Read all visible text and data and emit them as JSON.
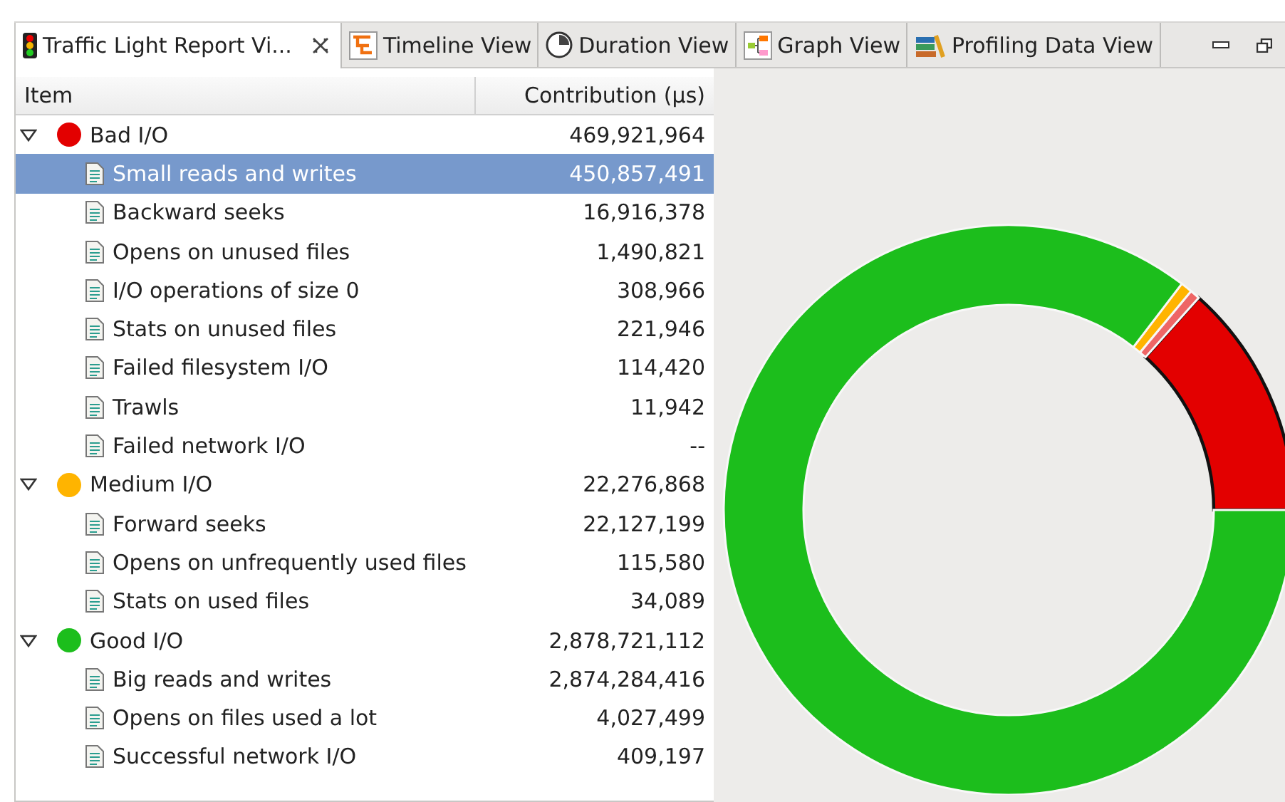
{
  "tabs": [
    {
      "label": "Traffic Light Report Vi...",
      "selected": true,
      "closable": true
    },
    {
      "label": "Timeline View",
      "selected": false,
      "closable": false
    },
    {
      "label": "Duration View",
      "selected": false,
      "closable": false
    },
    {
      "label": "Graph View",
      "selected": false,
      "closable": false
    },
    {
      "label": "Profiling Data View",
      "selected": false,
      "closable": false
    }
  ],
  "table": {
    "columns": [
      "Item",
      "Contribution (µs)"
    ],
    "rows": [
      {
        "label": "Bad I/O",
        "value": "469,921,964",
        "color": "#e30000",
        "expanded": true,
        "selected": false,
        "children": [
          {
            "label": "Small reads and writes",
            "value": "450,857,491",
            "selected": true
          },
          {
            "label": "Backward seeks",
            "value": "16,916,378",
            "selected": false
          },
          {
            "label": "Opens on unused files",
            "value": "1,490,821",
            "selected": false
          },
          {
            "label": "I/O operations of size 0",
            "value": "308,966",
            "selected": false
          },
          {
            "label": "Stats on unused files",
            "value": "221,946",
            "selected": false
          },
          {
            "label": "Failed filesystem I/O",
            "value": "114,420",
            "selected": false
          },
          {
            "label": "Trawls",
            "value": "11,942",
            "selected": false
          },
          {
            "label": "Failed network I/O",
            "value": "--",
            "selected": false
          }
        ]
      },
      {
        "label": "Medium I/O",
        "value": "22,276,868",
        "color": "#ffb400",
        "expanded": true,
        "selected": false,
        "children": [
          {
            "label": "Forward seeks",
            "value": "22,127,199",
            "selected": false
          },
          {
            "label": "Opens on unfrequently used files",
            "value": "115,580",
            "selected": false
          },
          {
            "label": "Stats on used files",
            "value": "34,089",
            "selected": false
          }
        ]
      },
      {
        "label": "Good I/O",
        "value": "2,878,721,112",
        "color": "#1cbe1c",
        "expanded": true,
        "selected": false,
        "children": [
          {
            "label": "Big reads and writes",
            "value": "2,874,284,416",
            "selected": false
          },
          {
            "label": "Opens on files used a lot",
            "value": "4,027,499",
            "selected": false
          },
          {
            "label": "Successful network I/O",
            "value": "409,197",
            "selected": false
          }
        ]
      }
    ]
  }
}
